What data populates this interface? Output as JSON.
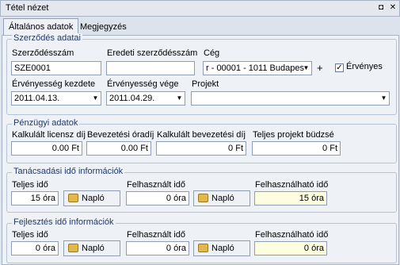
{
  "window": {
    "title": "Tétel nézet"
  },
  "tabs": [
    {
      "label": "Általános adatok",
      "active": true
    },
    {
      "label": "Megjegyzés",
      "active": false
    }
  ],
  "contract": {
    "group_title": "Szerződés adatai",
    "contract_no_label": "Szerződésszám",
    "contract_no_value": "SZE0001",
    "orig_contract_label": "Eredeti szerződésszám",
    "orig_contract_value": "",
    "company_label": "Cég",
    "company_value": "r - 00001 - 1011 Budapes",
    "add_label": "+",
    "valid_label": "Érvényes",
    "valid_checked": true,
    "valid_from_label": "Érvényesség kezdete",
    "valid_from_value": "2011.04.13.",
    "valid_to_label": "Érvényesség vége",
    "valid_to_value": "2011.04.29.",
    "project_label": "Projekt",
    "project_value": ""
  },
  "finance": {
    "group_title": "Pénzügyi adatok",
    "license_label": "Kalkulált licensz díj",
    "license_value": "0.00 Ft",
    "rate_label": "Bevezetési óradíj",
    "rate_value": "0.00 Ft",
    "intro_fee_label": "Kalkulált bevezetési díj",
    "intro_fee_value": "0 Ft",
    "budget_label": "Teljes projekt büdzsé",
    "budget_value": "0 Ft"
  },
  "consulting": {
    "group_title": "Tanácsadási idő információk",
    "total_label": "Teljes idő",
    "total_value": "15 óra",
    "log_label": "Napló",
    "used_label": "Felhasznált idő",
    "used_value": "0 óra",
    "log2_label": "Napló",
    "available_label": "Felhasználható idő",
    "available_value": "15 óra"
  },
  "development": {
    "group_title": "Fejlesztés idő információk",
    "total_label": "Teljes idő",
    "total_value": "0 óra",
    "log_label": "Napló",
    "used_label": "Felhasznált idő",
    "used_value": "0 óra",
    "log2_label": "Napló",
    "available_label": "Felhasználható idő",
    "available_value": "0 óra"
  }
}
